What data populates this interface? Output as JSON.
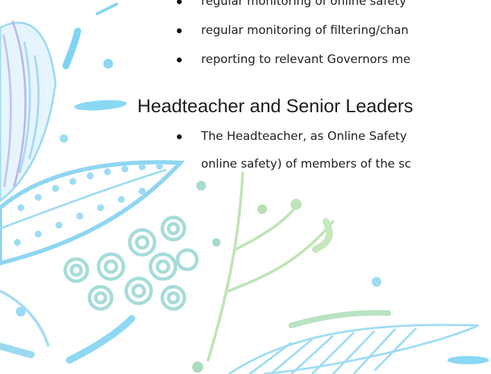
{
  "bullets_top": [
    "regular monitoring of online safety",
    "regular monitoring of filtering/chan",
    "reporting to relevant Governors me"
  ],
  "section": {
    "heading": "Headteacher and Senior Leaders",
    "paragraph_line1": "The Headteacher, as Online Safety",
    "paragraph_line2": "online safety) of members of the sc"
  },
  "colors": {
    "text": "#1f1f1f",
    "decor_blue": "#7fd4f1",
    "decor_purple": "#b6b6e6",
    "decor_green": "#a8dcae"
  }
}
